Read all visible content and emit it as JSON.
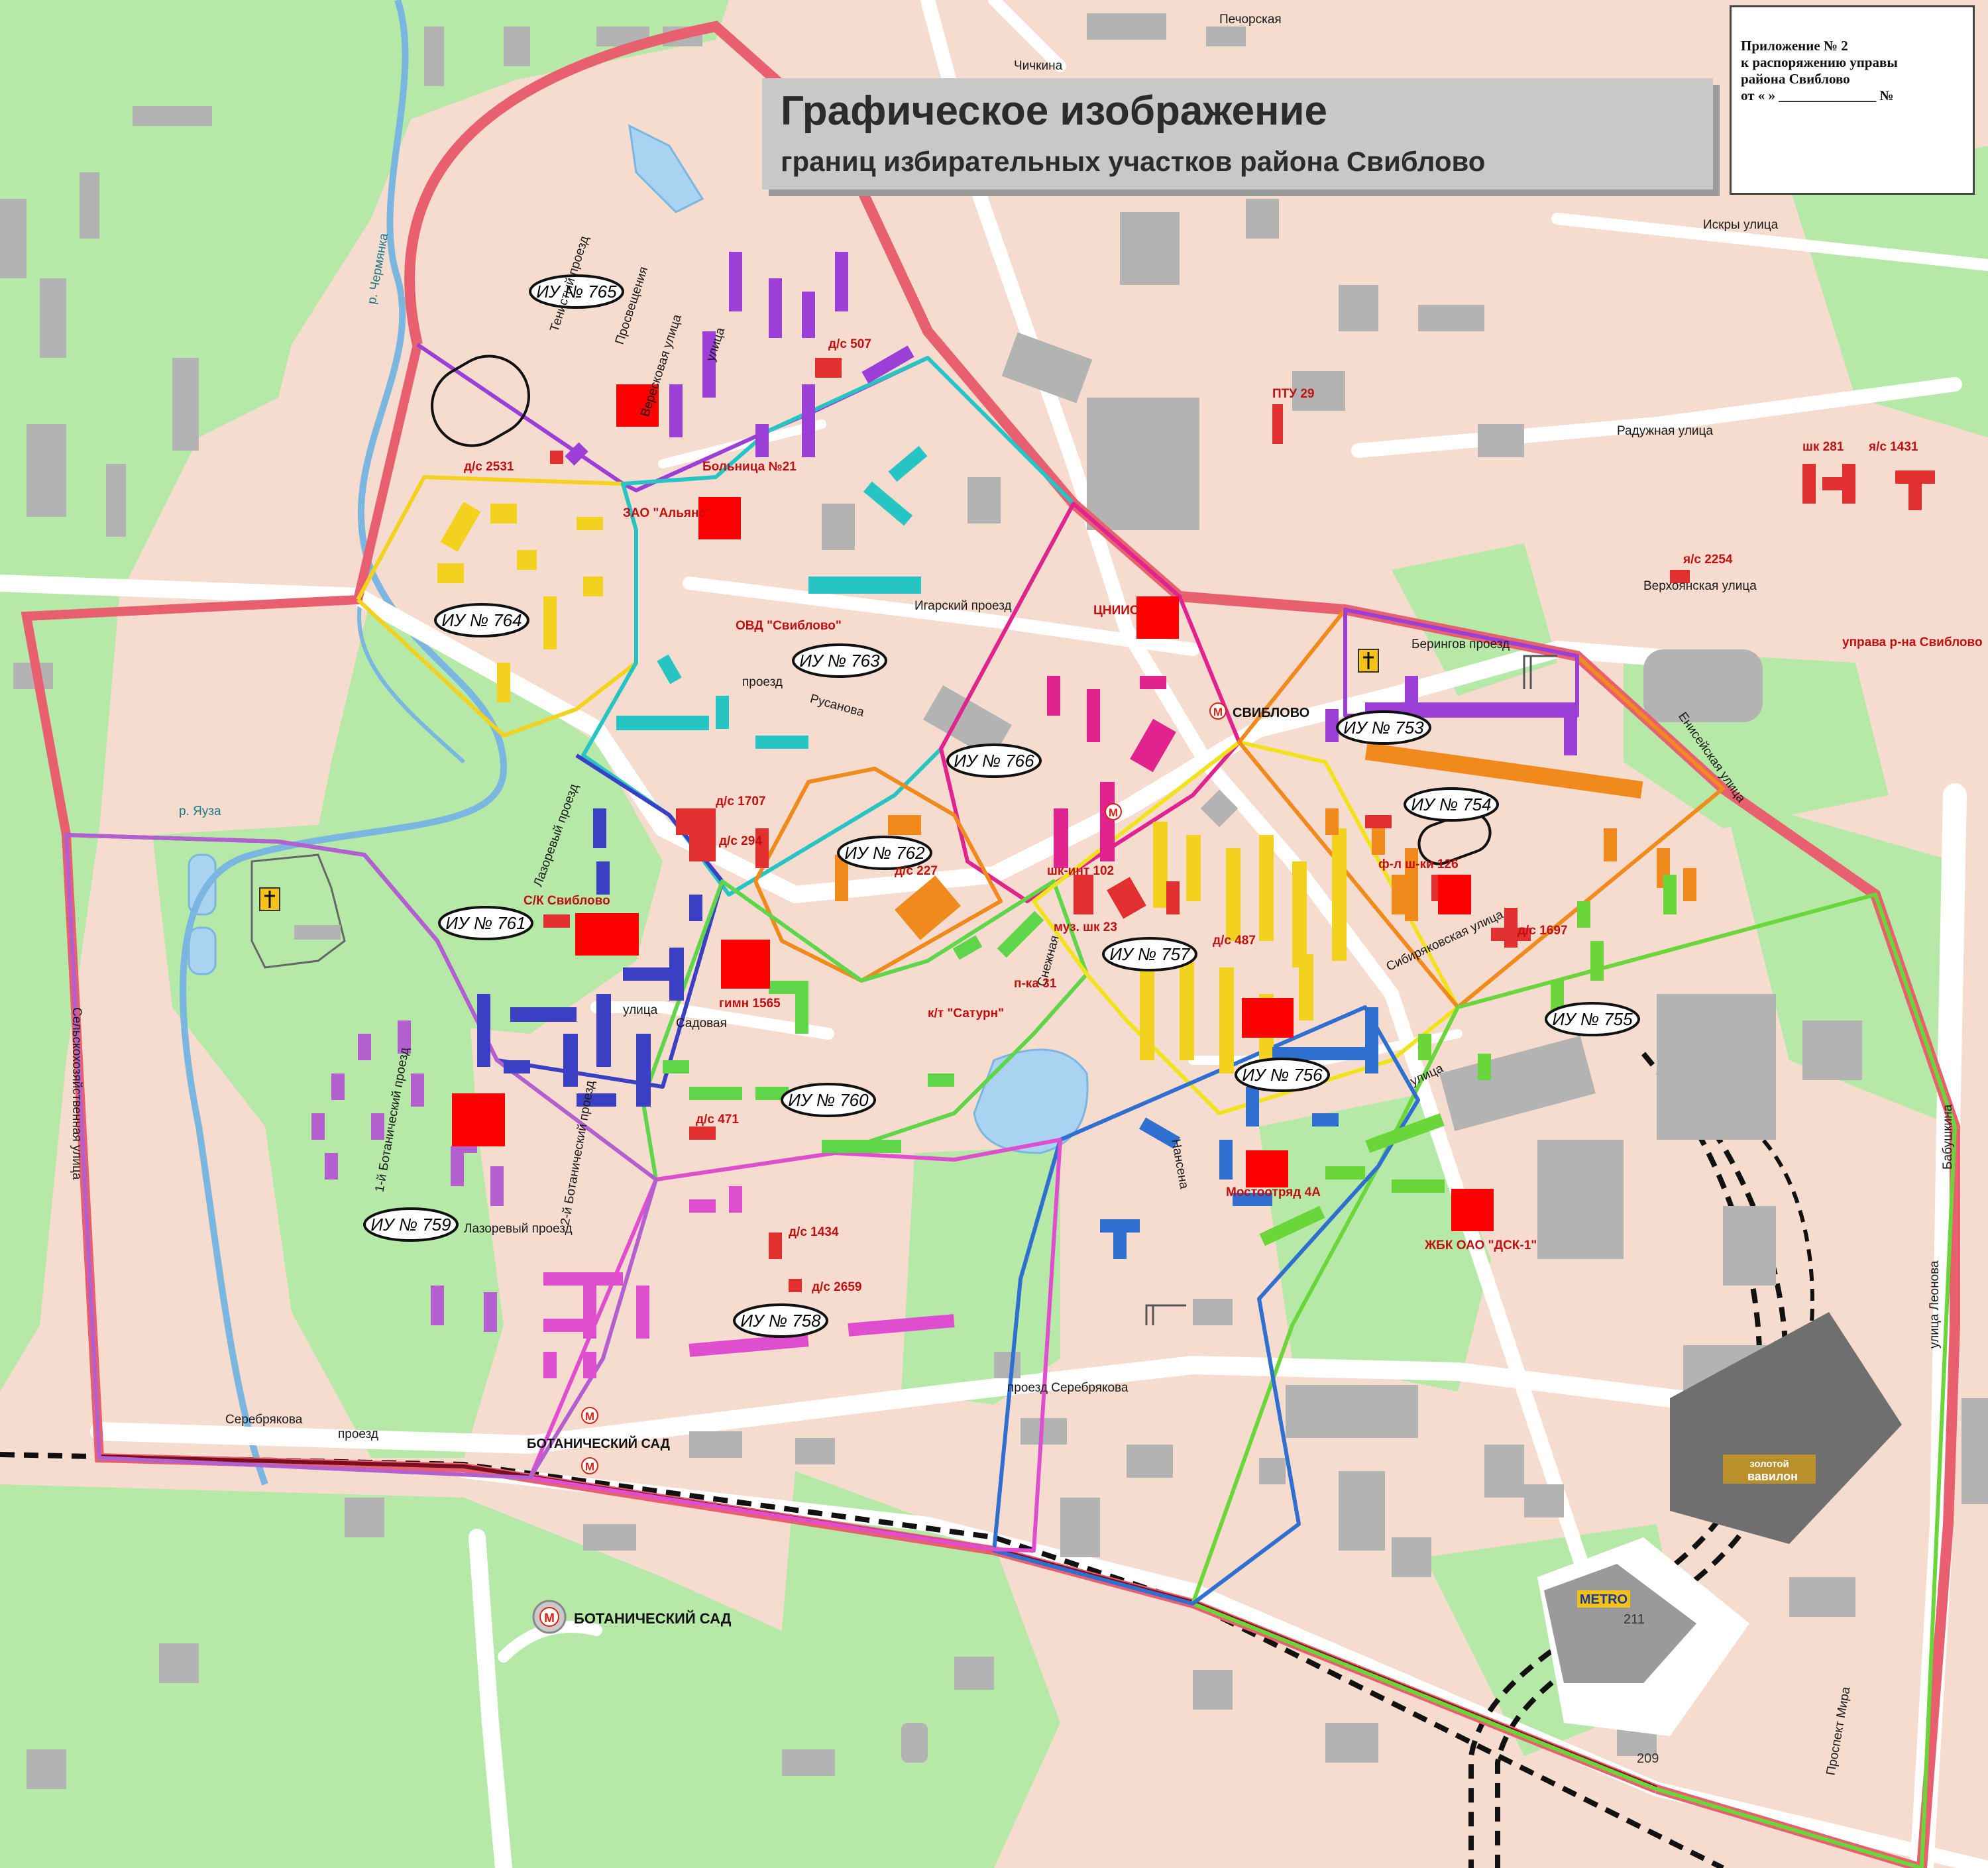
{
  "title": {
    "main": "Графическое изображение",
    "sub": "границ избирательных участков района Свиблово"
  },
  "annex": {
    "line1": "Приложение № 2",
    "line2": "к распоряжению управы",
    "line3": "района Свиблово",
    "line4": "от «    »  ______________ №"
  },
  "districts": [
    {
      "id": "d765",
      "label": "ИУ № 765",
      "color": "#9b3fd6"
    },
    {
      "id": "d764",
      "label": "ИУ № 764",
      "color": "#f2d21e"
    },
    {
      "id": "d763",
      "label": "ИУ № 763",
      "color": "#27c4c4"
    },
    {
      "id": "d766",
      "label": "ИУ № 766",
      "color": "#e0238e"
    },
    {
      "id": "d753",
      "label": "ИУ № 753",
      "color": "#9b3fd6"
    },
    {
      "id": "d754",
      "label": "ИУ № 754",
      "color": "#f08a1c"
    },
    {
      "id": "d762",
      "label": "ИУ № 762",
      "color": "#f08a1c"
    },
    {
      "id": "d761",
      "label": "ИУ № 761",
      "color": "#3a3fc4"
    },
    {
      "id": "d757",
      "label": "ИУ № 757",
      "color": "#f2e21e"
    },
    {
      "id": "d755",
      "label": "ИУ № 755",
      "color": "#6ad63a"
    },
    {
      "id": "d756",
      "label": "ИУ № 756",
      "color": "#2f6fd0"
    },
    {
      "id": "d760",
      "label": "ИУ № 760",
      "color": "#5fd64a"
    },
    {
      "id": "d759",
      "label": "ИУ № 759",
      "color": "#b45fd0"
    },
    {
      "id": "d758",
      "label": "ИУ № 758",
      "color": "#e04ed0"
    }
  ],
  "streets": {
    "teny": "Тенистый проезд",
    "prosv": "Просвещения",
    "prosv_ul": "улица",
    "veresk": "Вересковая улица",
    "igarsky": "Игарский проезд",
    "rusanova1": "проезд",
    "rusanova2": "Русанова",
    "radujnaya": "Радужная улица",
    "verkhoyanskaya": "Верхоянская улица",
    "beringov": "Берингов проезд",
    "eniseyskaya": "Енисейская улица",
    "sibiryakovskaya": "Сибиряковская улица",
    "lazorevy1": "Лазоревый проезд",
    "lazorevy2": "Лазоревый проезд",
    "sadovaya": "Садовая",
    "sadovaya_ul": "улица",
    "botan1": "1-й Ботанический проезд",
    "botan2": "2-й Ботанический проезд",
    "snejnaya": "Снежная",
    "nansena": "Нансена",
    "serebryakova1": "проезд Серебрякова",
    "serebryakova2": "Серебрякова",
    "serebryakova2b": "проезд",
    "selhoz": "Сельскохозяйственная улица",
    "iskry": "Искры улица",
    "pechorskaya": "Печорская",
    "chichkin": "Чичкина",
    "leonova": "улица Леонова",
    "babushkina": "Бабушкина",
    "prospekt_mira": "Проспект Мира",
    "chermyanka": "р. Чермянка",
    "yauza": "р. Яуза",
    "ulitsa_sib": "улица"
  },
  "landmarks": {
    "ds2531": "д/с 2531",
    "ds507": "д/с 507",
    "bolnitsa": "Больница №21",
    "zao_alians": "ЗАО \"Альянс\"",
    "ovd": "ОВД \"Свиблово\"",
    "ds1707": "д/с 1707",
    "ds294": "д/с 294",
    "ds227": "д/с 227",
    "sk_sviblovo": "С/К Свиблово",
    "gimn1565": "гимн 1565",
    "ds471": "д/с 471",
    "ds1434": "д/с 1434",
    "ds2659": "д/с 2659",
    "cniis": "ЦНИИС",
    "ptu29": "ПТУ 29",
    "shk281": "шк 281",
    "ys1431": "я/с 1431",
    "ys2254": "я/с 2254",
    "uprava": "управа р-на Свиблово",
    "sviblovo_metro": "СВИБЛОВО",
    "shk_int102": "шк-инт 102",
    "muz_shk23": "муз. шк 23",
    "ds487": "д/с 487",
    "pka31": "п-ка 31",
    "saturn": "к/т \"Сатурн\"",
    "fl_kii": "ф-л ш-ки 126",
    "ds1697": "д/с 1697",
    "mostotryad": "Мостоотряд 4А",
    "zhbk": "ЖБК ОАО \"ДСК-1\"",
    "botsad_metro": "БОТАНИЧЕСКИЙ САД",
    "botsad_metro2": "БОТАНИЧЕСКИЙ САД",
    "metro_brand": "METRO",
    "vavilon1": "золотой",
    "vavilon2": "вавилон",
    "n211": "211",
    "n209": "209"
  },
  "colors": {
    "background": "#f6dccf",
    "park": "#b6e8a8",
    "water": "#a9d3f0",
    "road": "#ffffff",
    "building": "#b3b3b3",
    "outer_boundary": "#e86070",
    "railway": "#6b1020",
    "polling_station": "#ff0000"
  },
  "icons": [
    "metro-icon",
    "church-icon",
    "crane-icon"
  ]
}
